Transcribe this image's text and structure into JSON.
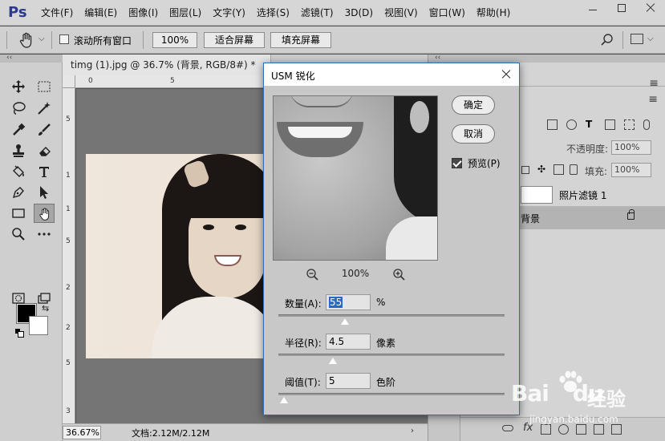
{
  "app": {
    "logo": "Ps"
  },
  "menu": [
    "文件(F)",
    "编辑(E)",
    "图像(I)",
    "图层(L)",
    "文字(Y)",
    "选择(S)",
    "滤镜(T)",
    "3D(D)",
    "视图(V)",
    "窗口(W)",
    "帮助(H)"
  ],
  "options": {
    "scroll_all_label": "滚动所有窗口",
    "zoom_100": "100%",
    "fit_screen": "适合屏幕",
    "fill_screen": "填充屏幕"
  },
  "document": {
    "tab_title": "timg (1).jpg @ 36.7% (背景, RGB/8#) *",
    "ruler_top_ticks": [
      "0",
      "5"
    ],
    "ruler_left_ticks": [
      "5",
      "1",
      "1",
      "5",
      "2",
      "2",
      "5",
      "3"
    ],
    "zoom": "36.67%",
    "info": "文档:2.12M/2.12M"
  },
  "layers": {
    "opacity_label": "不透明度:",
    "opacity_value": "100%",
    "fill_label": "填充:",
    "fill_value": "100%",
    "items": [
      {
        "name": "照片滤镜 1"
      },
      {
        "name": "背景"
      }
    ],
    "fx_label": "fx"
  },
  "dialog": {
    "title": "USM 锐化",
    "ok": "确定",
    "cancel": "取消",
    "preview_label": "预览(P)",
    "preview_checked": true,
    "preview_zoom": "100%",
    "amount": {
      "label": "数量(A):",
      "value": "55",
      "unit": "%"
    },
    "radius": {
      "label": "半径(R):",
      "value": "4.5",
      "unit": "像素"
    },
    "threshold": {
      "label": "阈值(T):",
      "value": "5",
      "unit": "色阶"
    }
  },
  "watermark": {
    "logo": "Bai",
    "logo_tail": "du",
    "cn": "经验",
    "url": "jingyan.baidu.com"
  }
}
